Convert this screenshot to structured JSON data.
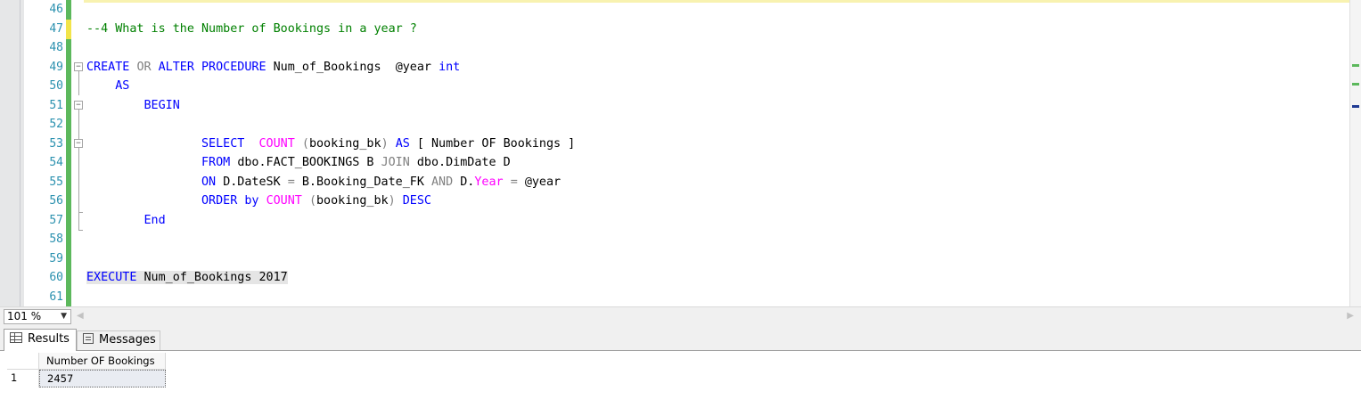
{
  "editor": {
    "line_numbers": [
      "46",
      "47",
      "48",
      "49",
      "50",
      "51",
      "52",
      "53",
      "54",
      "55",
      "56",
      "57",
      "58",
      "59",
      "60",
      "61"
    ],
    "code": {
      "l47": {
        "comment": "--4 What is the Number of Bookings in a year ?"
      },
      "l49": {
        "kw_create": "CREATE",
        "kw_or": "OR",
        "kw_alter": "ALTER",
        "kw_procedure": "PROCEDURE",
        "proc_name": "Num_of_Bookings",
        "param": "@year",
        "param_type": "int"
      },
      "l50": {
        "kw_as": "AS"
      },
      "l51": {
        "kw_begin": "BEGIN"
      },
      "l53": {
        "kw_select": "SELECT",
        "fn_count": "COUNT",
        "paren_open": "(",
        "col": "booking_bk",
        "paren_close": ")",
        "kw_as": "AS",
        "alias": "[ Number OF Bookings ]"
      },
      "l54": {
        "kw_from": "FROM",
        "table1": "dbo.FACT_BOOKINGS B",
        "kw_join": "JOIN",
        "table2": "dbo.DimDate D"
      },
      "l55": {
        "kw_on": "ON",
        "cond1": "D.DateSK",
        "eq1": "=",
        "cond2": "B.Booking_Date_FK",
        "kw_and": "AND",
        "cond3_prefix": "D.",
        "fn_year": "Year",
        "eq2": "=",
        "cond4": "@year"
      },
      "l56": {
        "kw_order": "ORDER",
        "kw_by": "by",
        "fn_count": "COUNT",
        "paren_open": "(",
        "col": "booking_bk",
        "paren_close": ")",
        "kw_desc": "DESC"
      },
      "l57": {
        "kw_end": "End"
      },
      "l60": {
        "kw_execute": "EXECUTE",
        "rest": "Num_of_Bookings 2017"
      }
    },
    "colors": {
      "keyword": "#0000ff",
      "function": "#ff00ff",
      "operator": "#808080",
      "comment": "#008000",
      "line_number": "#2b91af",
      "change_bar": "#5cb85c"
    }
  },
  "zoom": {
    "value": "101 %"
  },
  "results": {
    "tabs": [
      {
        "label": "Results",
        "icon": "grid-icon"
      },
      {
        "label": "Messages",
        "icon": "messages-icon"
      }
    ],
    "grid": {
      "columns": [
        "Number OF Bookings"
      ],
      "rows": [
        {
          "row_number": "1",
          "cells": [
            "2457"
          ]
        }
      ]
    }
  }
}
